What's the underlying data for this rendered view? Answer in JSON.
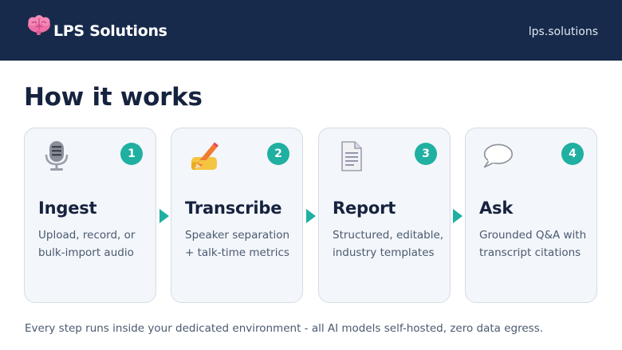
{
  "header": {
    "brand": "LPS Solutions",
    "logo_icon": "brain-icon",
    "site_url": "lps.solutions",
    "background": "#172a4b"
  },
  "title": "How it works",
  "accent_color": "#1fb0a1",
  "steps": [
    {
      "number": "1",
      "icon": "microphone-icon",
      "title": "Ingest",
      "description": "Upload, record, or bulk-import audio"
    },
    {
      "number": "2",
      "icon": "writing-hand-icon",
      "title": "Transcribe",
      "description": "Speaker separation + talk-time metrics"
    },
    {
      "number": "3",
      "icon": "document-icon",
      "title": "Report",
      "description": "Structured, editable, industry templates"
    },
    {
      "number": "4",
      "icon": "speech-bubble-icon",
      "title": "Ask",
      "description": "Grounded Q&A with transcript citations"
    }
  ],
  "footer": "Every step runs inside your dedicated environment - all AI models self-hosted, zero data egress."
}
